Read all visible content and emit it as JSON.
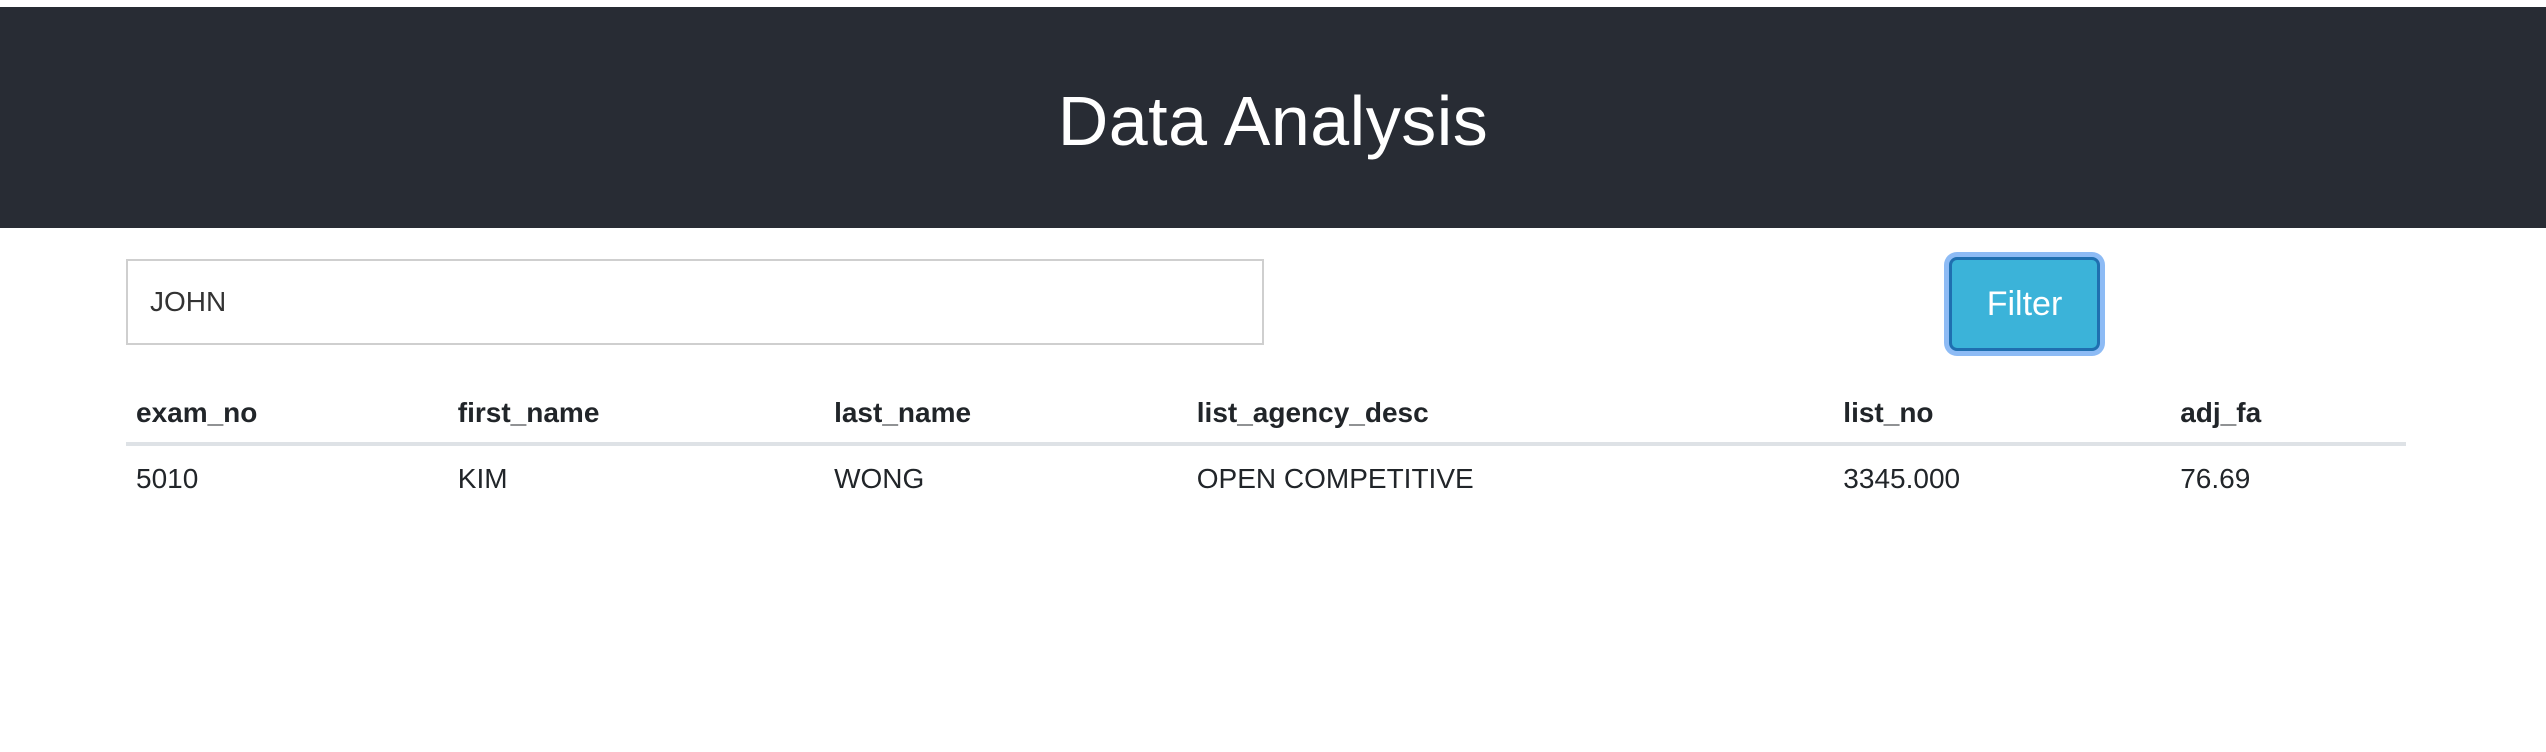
{
  "header": {
    "title": "Data Analysis"
  },
  "search": {
    "value": "JOHN"
  },
  "filter_button": {
    "label": "Filter"
  },
  "table": {
    "columns": [
      "exam_no",
      "first_name",
      "last_name",
      "list_agency_desc",
      "list_no",
      "adj_fa"
    ],
    "rows": [
      [
        "5010",
        "KIM",
        "WONG",
        "OPEN COMPETITIVE",
        "3345.000",
        "76.69"
      ]
    ]
  },
  "colors": {
    "header_bg": "#282c34",
    "button_bg": "#3bb3d9",
    "button_border": "#1f6fb0"
  }
}
